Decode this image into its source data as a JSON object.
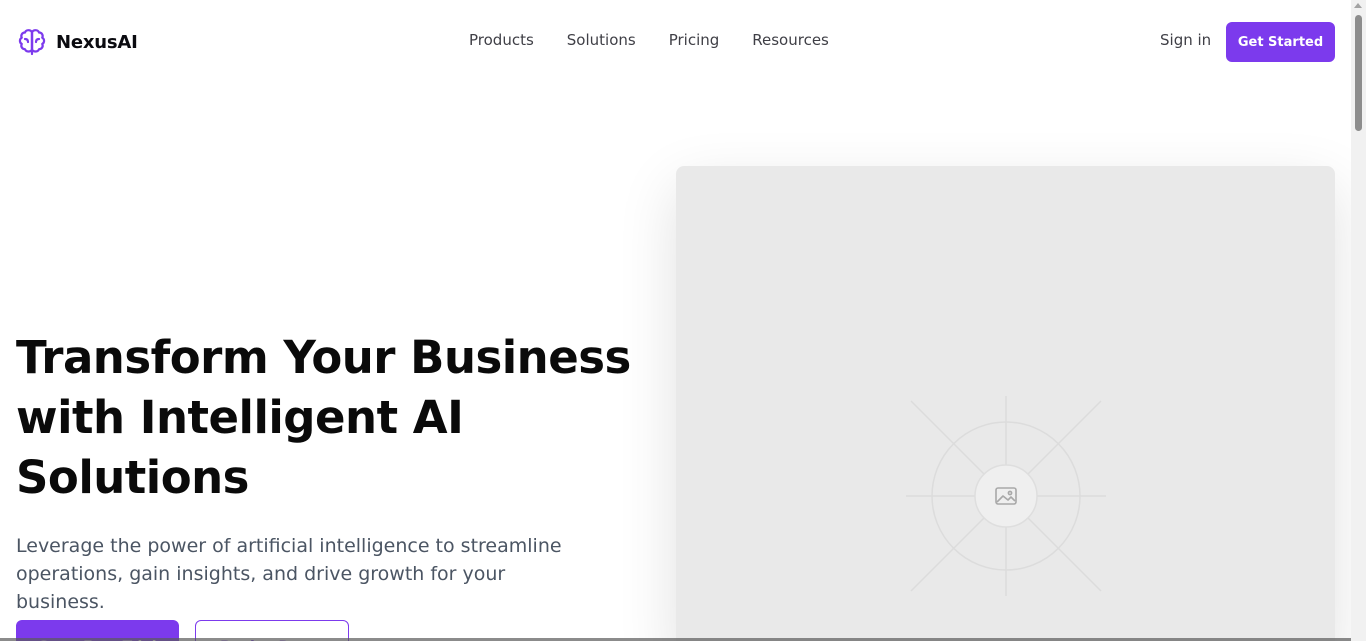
{
  "brand": {
    "name": "NexusAI",
    "icon": "brain-icon",
    "color": "#7c3aed"
  },
  "nav": {
    "items": [
      "Products",
      "Solutions",
      "Pricing",
      "Resources"
    ]
  },
  "header": {
    "signin_label": "Sign in",
    "cta_label": "Get Started"
  },
  "hero": {
    "title_line1": "Transform Your Business",
    "title_line2": "with Intelligent AI",
    "title_line3": "Solutions",
    "subtitle_line1": "Leverage the power of artificial intelligence to streamline",
    "subtitle_line2": "operations, gain insights, and drive growth for your business.",
    "primary_button": "Start Free Trial",
    "secondary_button": "Book a Demo",
    "media_icon": "image-placeholder-icon"
  },
  "colors": {
    "accent": "#7c3aed",
    "placeholder_bg": "#e9e9e9"
  }
}
